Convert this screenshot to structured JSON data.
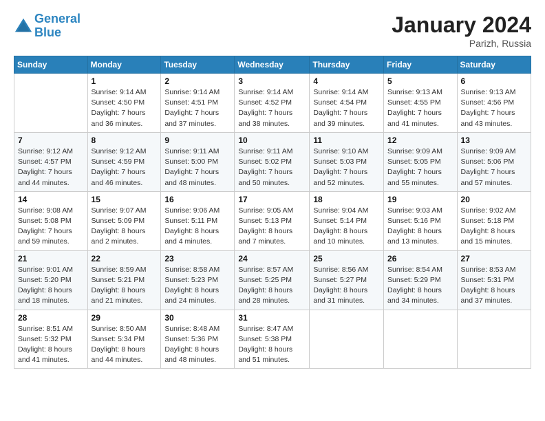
{
  "logo": {
    "line1": "General",
    "line2": "Blue"
  },
  "title": "January 2024",
  "location": "Parizh, Russia",
  "days_header": [
    "Sunday",
    "Monday",
    "Tuesday",
    "Wednesday",
    "Thursday",
    "Friday",
    "Saturday"
  ],
  "weeks": [
    [
      {
        "day": "",
        "sunrise": "",
        "sunset": "",
        "daylight": ""
      },
      {
        "day": "1",
        "sunrise": "Sunrise: 9:14 AM",
        "sunset": "Sunset: 4:50 PM",
        "daylight": "Daylight: 7 hours and 36 minutes."
      },
      {
        "day": "2",
        "sunrise": "Sunrise: 9:14 AM",
        "sunset": "Sunset: 4:51 PM",
        "daylight": "Daylight: 7 hours and 37 minutes."
      },
      {
        "day": "3",
        "sunrise": "Sunrise: 9:14 AM",
        "sunset": "Sunset: 4:52 PM",
        "daylight": "Daylight: 7 hours and 38 minutes."
      },
      {
        "day": "4",
        "sunrise": "Sunrise: 9:14 AM",
        "sunset": "Sunset: 4:54 PM",
        "daylight": "Daylight: 7 hours and 39 minutes."
      },
      {
        "day": "5",
        "sunrise": "Sunrise: 9:13 AM",
        "sunset": "Sunset: 4:55 PM",
        "daylight": "Daylight: 7 hours and 41 minutes."
      },
      {
        "day": "6",
        "sunrise": "Sunrise: 9:13 AM",
        "sunset": "Sunset: 4:56 PM",
        "daylight": "Daylight: 7 hours and 43 minutes."
      }
    ],
    [
      {
        "day": "7",
        "sunrise": "Sunrise: 9:12 AM",
        "sunset": "Sunset: 4:57 PM",
        "daylight": "Daylight: 7 hours and 44 minutes."
      },
      {
        "day": "8",
        "sunrise": "Sunrise: 9:12 AM",
        "sunset": "Sunset: 4:59 PM",
        "daylight": "Daylight: 7 hours and 46 minutes."
      },
      {
        "day": "9",
        "sunrise": "Sunrise: 9:11 AM",
        "sunset": "Sunset: 5:00 PM",
        "daylight": "Daylight: 7 hours and 48 minutes."
      },
      {
        "day": "10",
        "sunrise": "Sunrise: 9:11 AM",
        "sunset": "Sunset: 5:02 PM",
        "daylight": "Daylight: 7 hours and 50 minutes."
      },
      {
        "day": "11",
        "sunrise": "Sunrise: 9:10 AM",
        "sunset": "Sunset: 5:03 PM",
        "daylight": "Daylight: 7 hours and 52 minutes."
      },
      {
        "day": "12",
        "sunrise": "Sunrise: 9:09 AM",
        "sunset": "Sunset: 5:05 PM",
        "daylight": "Daylight: 7 hours and 55 minutes."
      },
      {
        "day": "13",
        "sunrise": "Sunrise: 9:09 AM",
        "sunset": "Sunset: 5:06 PM",
        "daylight": "Daylight: 7 hours and 57 minutes."
      }
    ],
    [
      {
        "day": "14",
        "sunrise": "Sunrise: 9:08 AM",
        "sunset": "Sunset: 5:08 PM",
        "daylight": "Daylight: 7 hours and 59 minutes."
      },
      {
        "day": "15",
        "sunrise": "Sunrise: 9:07 AM",
        "sunset": "Sunset: 5:09 PM",
        "daylight": "Daylight: 8 hours and 2 minutes."
      },
      {
        "day": "16",
        "sunrise": "Sunrise: 9:06 AM",
        "sunset": "Sunset: 5:11 PM",
        "daylight": "Daylight: 8 hours and 4 minutes."
      },
      {
        "day": "17",
        "sunrise": "Sunrise: 9:05 AM",
        "sunset": "Sunset: 5:13 PM",
        "daylight": "Daylight: 8 hours and 7 minutes."
      },
      {
        "day": "18",
        "sunrise": "Sunrise: 9:04 AM",
        "sunset": "Sunset: 5:14 PM",
        "daylight": "Daylight: 8 hours and 10 minutes."
      },
      {
        "day": "19",
        "sunrise": "Sunrise: 9:03 AM",
        "sunset": "Sunset: 5:16 PM",
        "daylight": "Daylight: 8 hours and 13 minutes."
      },
      {
        "day": "20",
        "sunrise": "Sunrise: 9:02 AM",
        "sunset": "Sunset: 5:18 PM",
        "daylight": "Daylight: 8 hours and 15 minutes."
      }
    ],
    [
      {
        "day": "21",
        "sunrise": "Sunrise: 9:01 AM",
        "sunset": "Sunset: 5:20 PM",
        "daylight": "Daylight: 8 hours and 18 minutes."
      },
      {
        "day": "22",
        "sunrise": "Sunrise: 8:59 AM",
        "sunset": "Sunset: 5:21 PM",
        "daylight": "Daylight: 8 hours and 21 minutes."
      },
      {
        "day": "23",
        "sunrise": "Sunrise: 8:58 AM",
        "sunset": "Sunset: 5:23 PM",
        "daylight": "Daylight: 8 hours and 24 minutes."
      },
      {
        "day": "24",
        "sunrise": "Sunrise: 8:57 AM",
        "sunset": "Sunset: 5:25 PM",
        "daylight": "Daylight: 8 hours and 28 minutes."
      },
      {
        "day": "25",
        "sunrise": "Sunrise: 8:56 AM",
        "sunset": "Sunset: 5:27 PM",
        "daylight": "Daylight: 8 hours and 31 minutes."
      },
      {
        "day": "26",
        "sunrise": "Sunrise: 8:54 AM",
        "sunset": "Sunset: 5:29 PM",
        "daylight": "Daylight: 8 hours and 34 minutes."
      },
      {
        "day": "27",
        "sunrise": "Sunrise: 8:53 AM",
        "sunset": "Sunset: 5:31 PM",
        "daylight": "Daylight: 8 hours and 37 minutes."
      }
    ],
    [
      {
        "day": "28",
        "sunrise": "Sunrise: 8:51 AM",
        "sunset": "Sunset: 5:32 PM",
        "daylight": "Daylight: 8 hours and 41 minutes."
      },
      {
        "day": "29",
        "sunrise": "Sunrise: 8:50 AM",
        "sunset": "Sunset: 5:34 PM",
        "daylight": "Daylight: 8 hours and 44 minutes."
      },
      {
        "day": "30",
        "sunrise": "Sunrise: 8:48 AM",
        "sunset": "Sunset: 5:36 PM",
        "daylight": "Daylight: 8 hours and 48 minutes."
      },
      {
        "day": "31",
        "sunrise": "Sunrise: 8:47 AM",
        "sunset": "Sunset: 5:38 PM",
        "daylight": "Daylight: 8 hours and 51 minutes."
      },
      {
        "day": "",
        "sunrise": "",
        "sunset": "",
        "daylight": ""
      },
      {
        "day": "",
        "sunrise": "",
        "sunset": "",
        "daylight": ""
      },
      {
        "day": "",
        "sunrise": "",
        "sunset": "",
        "daylight": ""
      }
    ]
  ]
}
